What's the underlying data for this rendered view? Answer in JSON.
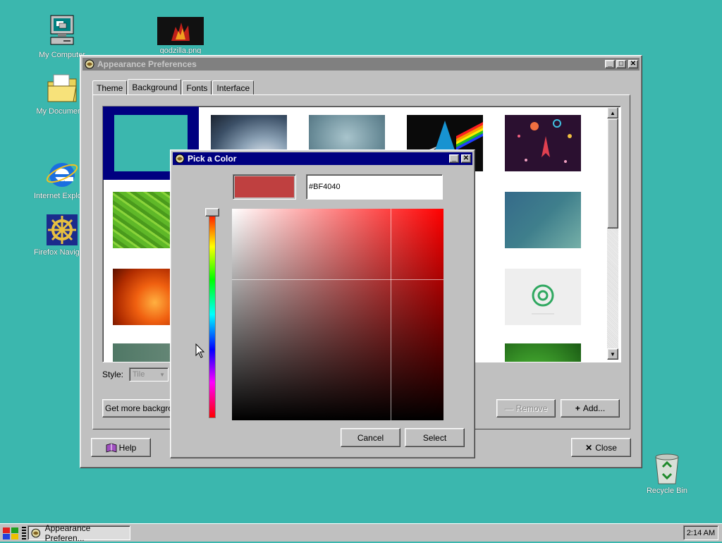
{
  "desktop": {
    "icons": [
      {
        "label": "My Computer"
      },
      {
        "label": "godzilla.png"
      },
      {
        "label": "My Documents"
      },
      {
        "label": "Internet Explorer"
      },
      {
        "label": "Firefox Navigator"
      },
      {
        "label": "Recycle Bin"
      }
    ]
  },
  "appearance": {
    "title": "Appearance Preferences",
    "tabs": [
      "Theme",
      "Background",
      "Fonts",
      "Interface"
    ],
    "selected_tab": "Background",
    "style_label": "Style:",
    "style_value": "Tile",
    "get_more_label": "Get more backgrounds",
    "remove_label": "Remove",
    "add_label": "Add...",
    "help_label": "Help",
    "close_label": "Close"
  },
  "picker": {
    "title": "Pick a Color",
    "hex_value": "#BF4040",
    "swatch_color": "#bf4040",
    "cancel_label": "Cancel",
    "select_label": "Select"
  },
  "taskbar": {
    "task_label": "Appearance Preferen...",
    "clock": "2:14 AM"
  },
  "colors": {
    "desktop": "#3bb7ae",
    "selection": "#000080",
    "picker_hue": "#ff0000"
  }
}
